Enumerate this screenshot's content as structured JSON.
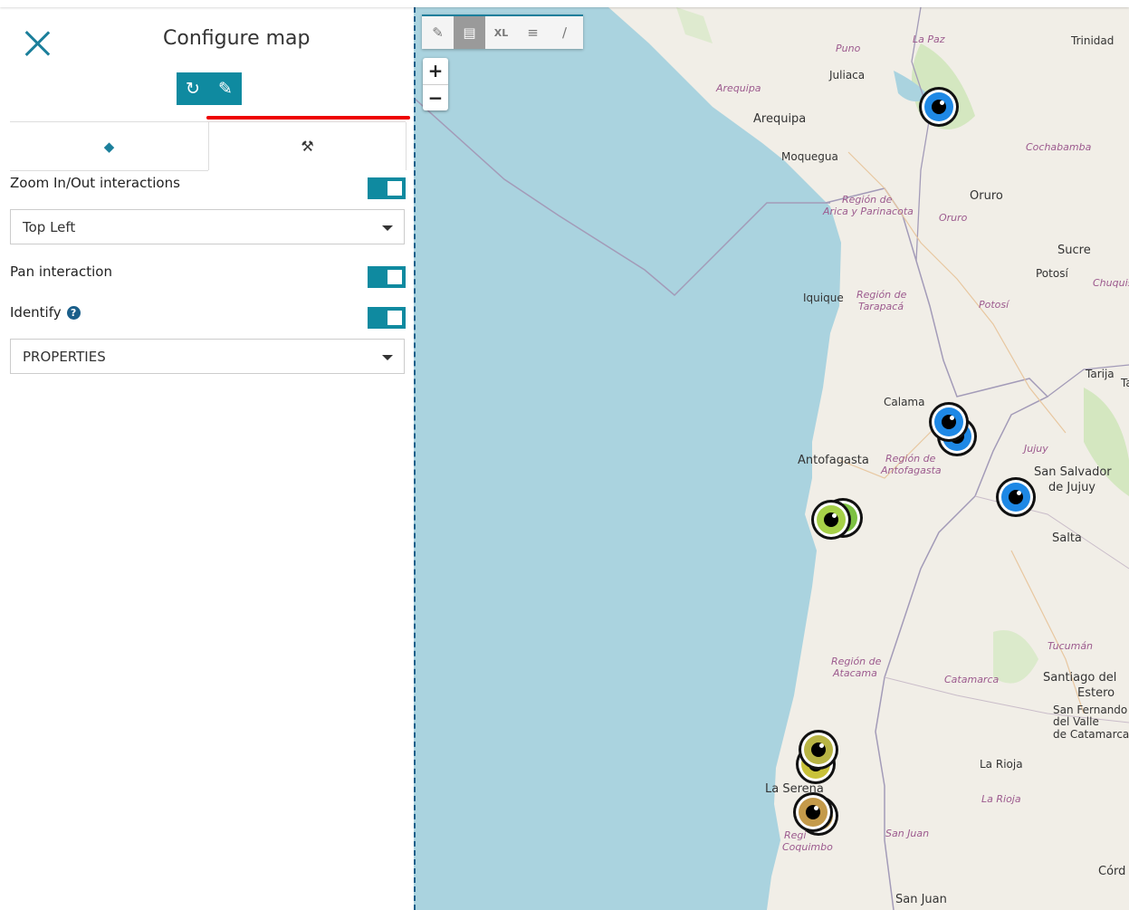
{
  "panel": {
    "title": "Configure map",
    "tabs": [
      {
        "icon": "layers-icon",
        "glyph": "◆"
      },
      {
        "icon": "wrench-icon",
        "glyph": "🔧"
      }
    ],
    "zoom_label": "Zoom In/Out interactions",
    "zoom_position": "Top Left",
    "pan_label": "Pan interaction",
    "identify_label": "Identify",
    "identify_mode": "PROPERTIES",
    "accent_color": "#0f8aa0"
  },
  "map": {
    "toolbar": [
      {
        "name": "draw-icon",
        "glyph": "✎"
      },
      {
        "name": "map-info-icon",
        "glyph": "▤"
      },
      {
        "name": "size-xl",
        "glyph": "XL"
      },
      {
        "name": "align-icon",
        "glyph": "≡"
      },
      {
        "name": "color-picker-icon",
        "glyph": "∕"
      }
    ],
    "zoom_in": "+",
    "zoom_out": "−",
    "places": [
      "Puno",
      "La Paz",
      "Trinidad",
      "Juliaca",
      "Arequipa",
      "Arequipa",
      "Moquegua",
      "Cochabamba",
      "Región de",
      "Arica y Parinacota",
      "Oruro",
      "Oruro",
      "Sucre",
      "Potosí",
      "Chuquis",
      "Iquique",
      "Región de",
      "Tarapacá",
      "Potosí",
      "Tarija",
      "Calama",
      "Jujuy",
      "Antofagasta",
      "Región de",
      "Antofagasta",
      "San Salvador",
      "de Jujuy",
      "Salta",
      "Tucumán",
      "Región de",
      "Atacama",
      "Catamarca",
      "Santiago del",
      "Estero",
      "San Fernando",
      "del Valle",
      "de Catamarca",
      "La Rioja",
      "La Serena",
      "La Rioja",
      "Regi",
      "Coquimbo",
      "San Juan",
      "Córd",
      "San Juan",
      "Ta"
    ],
    "marker_colors": [
      "#1e88e5",
      "#8bc34a",
      "#c9c23a",
      "#c8a35a"
    ]
  }
}
